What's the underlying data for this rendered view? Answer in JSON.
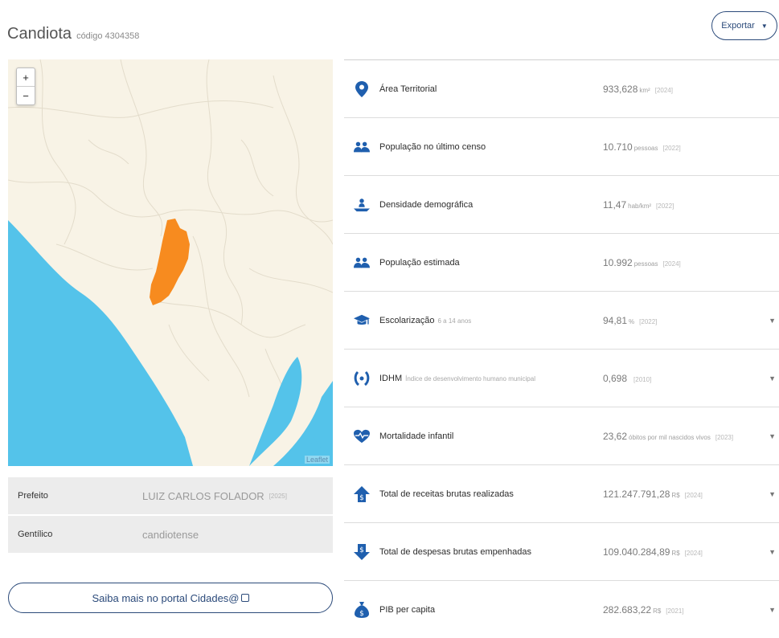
{
  "header": {
    "title": "Candiota",
    "code": "código 4304358",
    "export_label": "Exportar"
  },
  "map": {
    "attribution": "Leaflet",
    "zoom_in": "+",
    "zoom_out": "−",
    "highlight_color": "#f78b1f",
    "water_color": "#54c3ea",
    "land_color": "#f8f3e6"
  },
  "info": [
    {
      "label": "Prefeito",
      "value": "LUIZ CARLOS FOLADOR",
      "year": "[2025]"
    },
    {
      "label": "Gentílico",
      "value": "candiotense",
      "year": ""
    }
  ],
  "portal_button": "Saiba mais no portal Cidades@",
  "indicators": [
    {
      "icon": "location-pin-icon",
      "name": "Área Territorial",
      "sub": "",
      "value": "933,628",
      "unit": "km²",
      "year": "[2024]",
      "expandable": false
    },
    {
      "icon": "people-icon",
      "name": "População no último censo",
      "sub": "",
      "value": "10.710",
      "unit": "pessoas",
      "year": "[2022]",
      "expandable": false
    },
    {
      "icon": "density-icon",
      "name": "Densidade demográfica",
      "sub": "",
      "value": "11,47",
      "unit": "hab/km²",
      "year": "[2022]",
      "expandable": false
    },
    {
      "icon": "people-icon",
      "name": "População estimada",
      "sub": "",
      "value": "10.992",
      "unit": "pessoas",
      "year": "[2024]",
      "expandable": false
    },
    {
      "icon": "graduation-cap-icon",
      "name": "Escolarização",
      "sub": "6 a 14 anos",
      "value": "94,81",
      "unit": "%",
      "year": "[2022]",
      "expandable": true
    },
    {
      "icon": "laurel-icon",
      "name": "IDHM",
      "sub": "Índice de desenvolvimento humano municipal",
      "value": "0,698",
      "unit": "",
      "year": "[2010]",
      "expandable": true
    },
    {
      "icon": "heartbeat-icon",
      "name": "Mortalidade infantil",
      "sub": "",
      "value": "23,62",
      "unit": "óbitos por mil nascidos vivos",
      "year": "[2023]",
      "expandable": true
    },
    {
      "icon": "revenue-icon",
      "name": "Total de receitas brutas realizadas",
      "sub": "",
      "value": "121.247.791,28",
      "unit": "R$",
      "year": "[2024]",
      "expandable": true
    },
    {
      "icon": "expense-icon",
      "name": "Total de despesas brutas empenhadas",
      "sub": "",
      "value": "109.040.284,89",
      "unit": "R$",
      "year": "[2024]",
      "expandable": true
    },
    {
      "icon": "money-bag-icon",
      "name": "PIB per capita",
      "sub": "",
      "value": "282.683,22",
      "unit": "R$",
      "year": "[2021]",
      "expandable": true
    }
  ],
  "colors": {
    "accent": "#2b4a7a",
    "icon_blue": "#1f5fae"
  }
}
